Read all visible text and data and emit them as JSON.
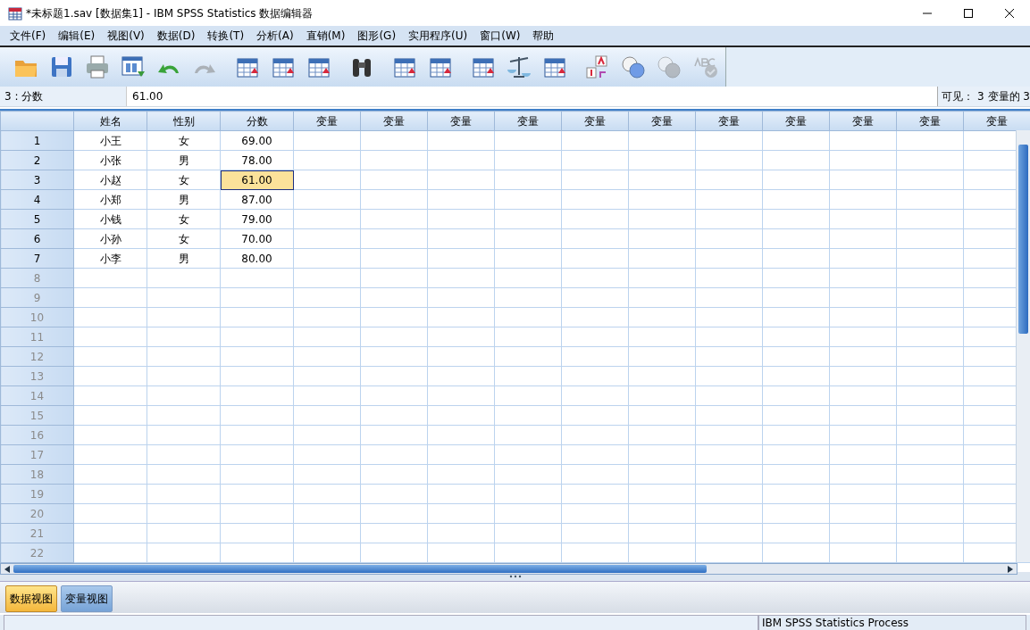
{
  "window": {
    "title": "*未标题1.sav [数据集1] - IBM SPSS Statistics 数据编辑器"
  },
  "menu": [
    "文件(F)",
    "编辑(E)",
    "视图(V)",
    "数据(D)",
    "转换(T)",
    "分析(A)",
    "直销(M)",
    "图形(G)",
    "实用程序(U)",
    "窗口(W)",
    "帮助"
  ],
  "toolbar": [
    [
      {
        "kind": "folder",
        "disabled": false
      },
      {
        "kind": "save",
        "disabled": false
      },
      {
        "kind": "printer",
        "disabled": false
      },
      {
        "kind": "dialog",
        "disabled": false
      },
      {
        "kind": "undo",
        "disabled": false
      },
      {
        "kind": "redo",
        "disabled": true
      }
    ],
    [
      {
        "kind": "table",
        "disabled": false
      },
      {
        "kind": "table",
        "disabled": false
      },
      {
        "kind": "table",
        "disabled": false
      }
    ],
    [
      {
        "kind": "binoculars",
        "disabled": false
      }
    ],
    [
      {
        "kind": "table",
        "disabled": false
      },
      {
        "kind": "table",
        "disabled": false
      }
    ],
    [
      {
        "kind": "table",
        "disabled": false
      },
      {
        "kind": "scale",
        "disabled": false
      },
      {
        "kind": "table",
        "disabled": false
      }
    ],
    [
      {
        "kind": "labels",
        "disabled": false
      },
      {
        "kind": "circles",
        "disabled": false
      },
      {
        "kind": "circles",
        "disabled": true
      },
      {
        "kind": "spell",
        "disabled": true
      }
    ]
  ],
  "cell_info": {
    "name": "3 : 分数",
    "value": "61.00",
    "visible": "可见： 3 变量的 3"
  },
  "columns": [
    "姓名",
    "性别",
    "分数",
    "变量",
    "变量",
    "变量",
    "变量",
    "变量",
    "变量",
    "变量",
    "变量",
    "变量",
    "变量",
    "变量"
  ],
  "rows": [
    {
      "number": "1",
      "cells": [
        {
          "text": "小王",
          "selected": false
        },
        {
          "text": "女",
          "selected": false
        },
        {
          "text": "69.00",
          "selected": false
        }
      ]
    },
    {
      "number": "2",
      "cells": [
        {
          "text": "小张",
          "selected": false
        },
        {
          "text": "男",
          "selected": false
        },
        {
          "text": "78.00",
          "selected": false
        }
      ]
    },
    {
      "number": "3",
      "cells": [
        {
          "text": "小赵",
          "selected": false
        },
        {
          "text": "女",
          "selected": false
        },
        {
          "text": "61.00",
          "selected": true
        }
      ]
    },
    {
      "number": "4",
      "cells": [
        {
          "text": "小郑",
          "selected": false
        },
        {
          "text": "男",
          "selected": false
        },
        {
          "text": "87.00",
          "selected": false
        }
      ]
    },
    {
      "number": "5",
      "cells": [
        {
          "text": "小钱",
          "selected": false
        },
        {
          "text": "女",
          "selected": false
        },
        {
          "text": "79.00",
          "selected": false
        }
      ]
    },
    {
      "number": "6",
      "cells": [
        {
          "text": "小孙",
          "selected": false
        },
        {
          "text": "女",
          "selected": false
        },
        {
          "text": "70.00",
          "selected": false
        }
      ]
    },
    {
      "number": "7",
      "cells": [
        {
          "text": "小李",
          "selected": false
        },
        {
          "text": "男",
          "selected": false
        },
        {
          "text": "80.00",
          "selected": false
        }
      ]
    },
    {
      "number": "8"
    },
    {
      "number": "9"
    },
    {
      "number": "10"
    },
    {
      "number": "11"
    },
    {
      "number": "12"
    },
    {
      "number": "13"
    },
    {
      "number": "14"
    },
    {
      "number": "15"
    },
    {
      "number": "16"
    },
    {
      "number": "17"
    },
    {
      "number": "18"
    },
    {
      "number": "19"
    },
    {
      "number": "20"
    },
    {
      "number": "21"
    },
    {
      "number": "22"
    }
  ],
  "tabs": [
    {
      "label": "数据视图",
      "selected": true
    },
    {
      "label": "变量视图",
      "selected": false
    }
  ],
  "status_bar": {
    "processor": "IBM SPSS Statistics Process"
  }
}
